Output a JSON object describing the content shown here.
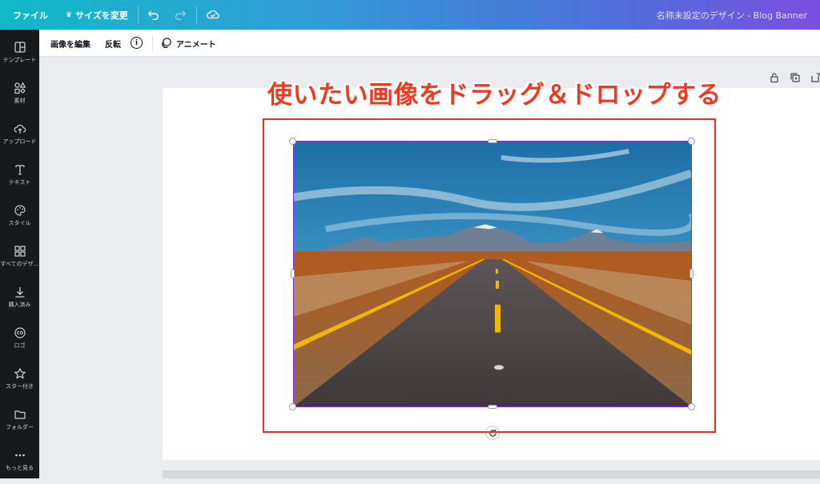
{
  "topbar": {
    "file_label": "ファイル",
    "resize_label": "サイズを変更",
    "document_title": "名称未設定のデザイン - Blog Banner"
  },
  "sidebar": {
    "items": [
      {
        "label": "テンプレート",
        "icon": "template-icon"
      },
      {
        "label": "素材",
        "icon": "elements-icon"
      },
      {
        "label": "アップロード",
        "icon": "upload-icon"
      },
      {
        "label": "テキスト",
        "icon": "text-icon"
      },
      {
        "label": "スタイル",
        "icon": "palette-icon"
      },
      {
        "label": "すべてのデザ…",
        "icon": "grid-icon"
      },
      {
        "label": "購入済み",
        "icon": "download-icon"
      },
      {
        "label": "ロゴ",
        "icon": "logo-icon"
      },
      {
        "label": "スター付き",
        "icon": "star-icon"
      },
      {
        "label": "フォルダー",
        "icon": "folder-icon"
      },
      {
        "label": "もっと見る",
        "icon": "more-icon"
      }
    ]
  },
  "context_toolbar": {
    "edit_image": "画像を編集",
    "flip": "反転",
    "info": "i",
    "animate": "アニメート"
  },
  "canvas": {
    "headline": "使いたい画像をドラッグ＆ドロップする"
  },
  "colors": {
    "accent_purple": "#7d2ae8",
    "annotation_red": "#e8331c",
    "sidebar_bg": "#18191b"
  }
}
